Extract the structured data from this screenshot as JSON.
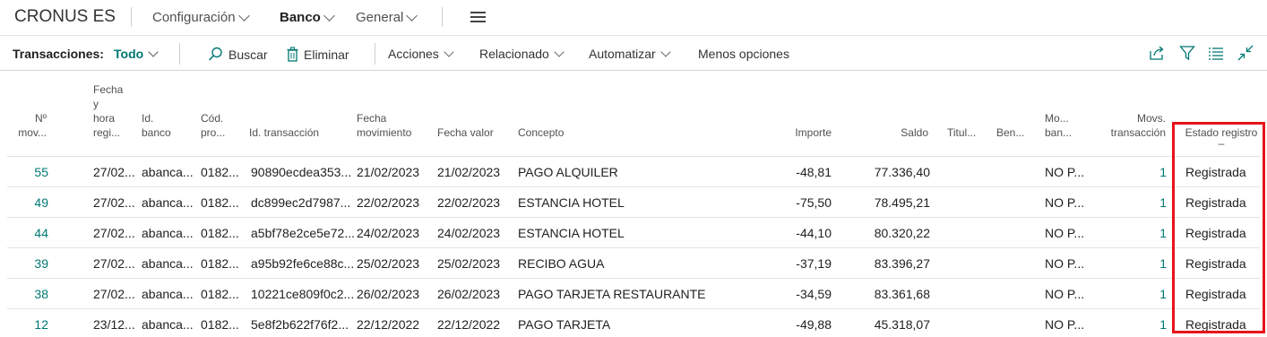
{
  "topbar": {
    "company": "CRONUS ES",
    "nav": [
      "Configuración",
      "Banco",
      "General"
    ]
  },
  "actionbar": {
    "label": "Transacciones:",
    "filter": "Todo",
    "search": "Buscar",
    "delete": "Eliminar",
    "actions": "Acciones",
    "related": "Relacionado",
    "automate": "Automatizar",
    "less": "Menos opciones"
  },
  "columns": {
    "no": [
      "Nº",
      "mov..."
    ],
    "datetime": [
      "Fecha",
      "y",
      "hora",
      "regi..."
    ],
    "bank_id": [
      "Id.",
      "banco"
    ],
    "code": [
      "Cód.",
      "pro..."
    ],
    "trans_id": "Id. transacción",
    "mov_date": [
      "Fecha",
      "movimiento"
    ],
    "value_date": "Fecha valor",
    "concept": "Concepto",
    "amount": "Importe",
    "balance": "Saldo",
    "holder": "Titul...",
    "beneficiary": "Ben...",
    "bank_mov": [
      "Mo...",
      "ban..."
    ],
    "movs": [
      "Movs.",
      "transacción"
    ],
    "status": [
      "Estado registro",
      "–"
    ]
  },
  "rows": [
    {
      "no": "55",
      "dt": "27/02...",
      "bank": "abanca...",
      "code": "0182...",
      "tid": "90890ecdea353...",
      "date": "21/02/2023",
      "vdate": "21/02/2023",
      "concept": "PAGO ALQUILER",
      "amount": "-48,81",
      "balance": "77.336,40",
      "bm": "NO P...",
      "movs": "1",
      "status": "Registrada"
    },
    {
      "no": "49",
      "dt": "27/02...",
      "bank": "abanca...",
      "code": "0182...",
      "tid": "dc899ec2d7987...",
      "date": "22/02/2023",
      "vdate": "22/02/2023",
      "concept": "ESTANCIA HOTEL",
      "amount": "-75,50",
      "balance": "78.495,21",
      "bm": "NO P...",
      "movs": "1",
      "status": "Registrada"
    },
    {
      "no": "44",
      "dt": "27/02...",
      "bank": "abanca...",
      "code": "0182...",
      "tid": "a5bf78e2ce5e72...",
      "date": "24/02/2023",
      "vdate": "24/02/2023",
      "concept": "ESTANCIA HOTEL",
      "amount": "-44,10",
      "balance": "80.320,22",
      "bm": "NO P...",
      "movs": "1",
      "status": "Registrada"
    },
    {
      "no": "39",
      "dt": "27/02...",
      "bank": "abanca...",
      "code": "0182...",
      "tid": "a95b92fe6ce88c...",
      "date": "25/02/2023",
      "vdate": "25/02/2023",
      "concept": "RECIBO AGUA",
      "amount": "-37,19",
      "balance": "83.396,27",
      "bm": "NO P...",
      "movs": "1",
      "status": "Registrada"
    },
    {
      "no": "38",
      "dt": "27/02...",
      "bank": "abanca...",
      "code": "0182...",
      "tid": "10221ce809f0c2...",
      "date": "26/02/2023",
      "vdate": "26/02/2023",
      "concept": "PAGO TARJETA RESTAURANTE",
      "amount": "-34,59",
      "balance": "83.361,68",
      "bm": "NO P...",
      "movs": "1",
      "status": "Registrada"
    },
    {
      "no": "12",
      "dt": "23/12...",
      "bank": "abanca...",
      "code": "0182...",
      "tid": "5e8f2b622f76f2...",
      "date": "22/12/2022",
      "vdate": "22/12/2022",
      "concept": "PAGO TARJETA",
      "amount": "-49,88",
      "balance": "45.318,07",
      "bm": "NO P...",
      "movs": "1",
      "status": "Registrada"
    }
  ],
  "colors": {
    "accent": "#007873",
    "highlight": "#e8141b"
  },
  "icons": [
    "search-icon",
    "trash-icon",
    "share-icon",
    "filter-icon",
    "list-icon",
    "collapse-icon",
    "hamburger-icon"
  ]
}
